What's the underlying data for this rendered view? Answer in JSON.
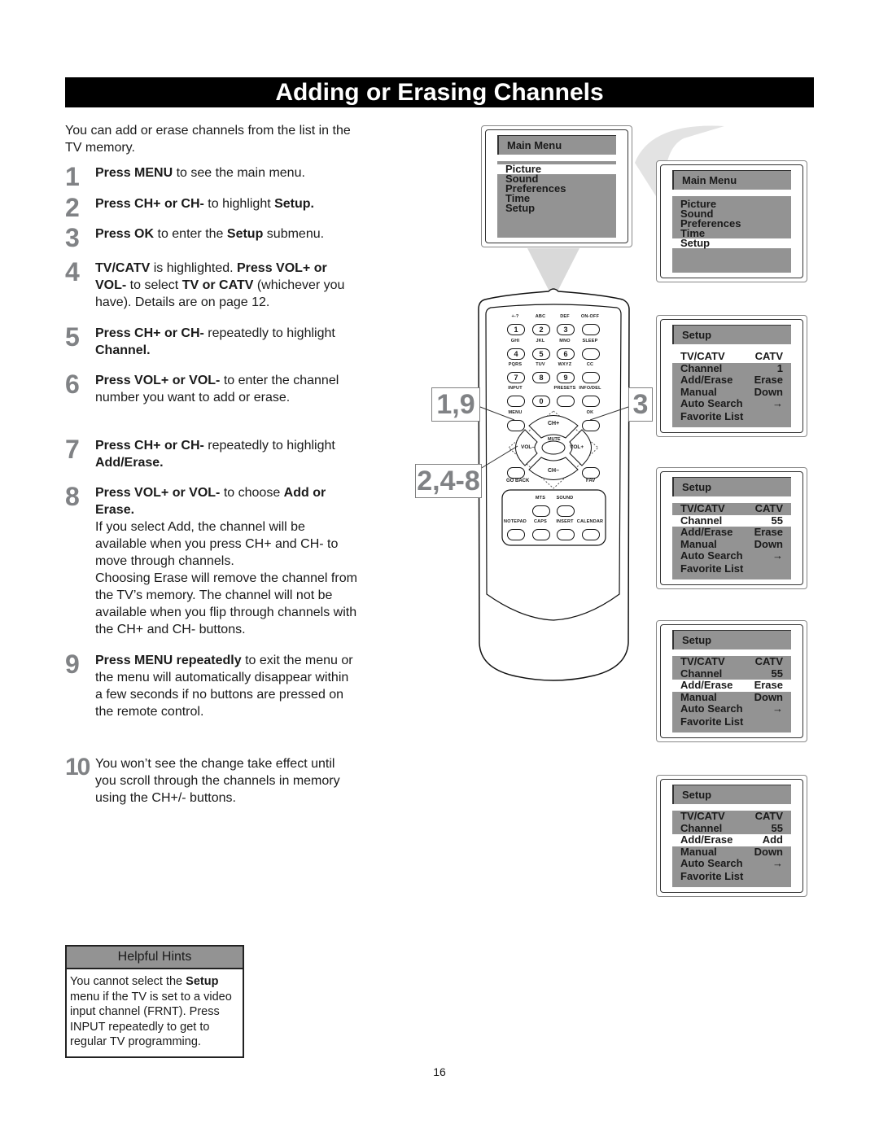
{
  "title": "Adding or Erasing Channels",
  "intro": "You can add or erase channels from the list in the TV memory.",
  "steps": [
    {
      "num": "1",
      "parts": [
        {
          "b": "Press MENU"
        },
        {
          "t": " to see the main menu."
        }
      ]
    },
    {
      "num": "2",
      "parts": [
        {
          "b": "Press CH+ or CH-"
        },
        {
          "t": " to highlight "
        },
        {
          "b": "Setup."
        }
      ]
    },
    {
      "num": "3",
      "parts": [
        {
          "b": "Press OK"
        },
        {
          "t": " to enter the "
        },
        {
          "b": "Setup"
        },
        {
          "t": " submenu."
        }
      ]
    },
    {
      "num": "4",
      "parts": [
        {
          "b": "TV/CATV"
        },
        {
          "t": " is highlighted. "
        },
        {
          "b": "Press VOL+ or VOL-"
        },
        {
          "t": " to select "
        },
        {
          "b": "TV or CATV"
        },
        {
          "t": " (whichever you have). Details are on page 12."
        }
      ]
    },
    {
      "num": "5",
      "parts": [
        {
          "b": "Press CH+ or CH-"
        },
        {
          "t": " repeatedly to highlight "
        },
        {
          "b": "Channel."
        }
      ]
    },
    {
      "num": "6",
      "parts": [
        {
          "b": "Press VOL+ or VOL-"
        },
        {
          "t": " to enter the channel number you want to add or erase."
        }
      ]
    },
    {
      "num": "7",
      "parts": [
        {
          "b": "Press CH+ or CH-"
        },
        {
          "t": " repeatedly to highlight "
        },
        {
          "b": "Add/Erase."
        }
      ]
    },
    {
      "num": "8",
      "parts": [
        {
          "b": "Press VOL+ or VOL-"
        },
        {
          "t": " to choose "
        },
        {
          "b": "Add or Erase."
        },
        {
          "br": true
        },
        {
          "t": "If you select Add, the channel will be available when you press CH+ and CH- to move through channels."
        },
        {
          "br": true
        },
        {
          "t": "Choosing Erase will remove the channel from the TV’s memory. The channel will not be available when you flip through channels with the CH+ and CH- buttons."
        }
      ]
    },
    {
      "num": "9",
      "parts": [
        {
          "b": "Press MENU repeatedly"
        },
        {
          "t": " to exit the menu or the menu will automatically disappear within a few seconds if no buttons are pressed on the remote control."
        }
      ]
    },
    {
      "num": "10",
      "parts": [
        {
          "t": "You won’t see the change take effect until you scroll through the channels in memory using the CH+/- buttons."
        }
      ]
    }
  ],
  "hints": {
    "header": "Helpful Hints",
    "parts": [
      {
        "t": "You cannot select the "
      },
      {
        "b": "Setup"
      },
      {
        "t": " menu if the TV is set to a video input channel (FRNT). Press INPUT repeatedly to get to regular TV programming."
      }
    ]
  },
  "page_number": "16",
  "callouts": {
    "left_top": "1,9",
    "left_bottom": "2,4-8",
    "right": "3"
  },
  "menus": [
    {
      "title": "Main Menu",
      "items": [
        {
          "l": "Picture"
        },
        {
          "l": "Sound"
        },
        {
          "l": "Preferences"
        },
        {
          "l": "Time"
        },
        {
          "l": "Setup"
        }
      ],
      "highlight": 0
    },
    {
      "title": "Main Menu",
      "items": [
        {
          "l": "Picture"
        },
        {
          "l": "Sound"
        },
        {
          "l": "Preferences"
        },
        {
          "l": "Time"
        },
        {
          "l": "Setup"
        }
      ],
      "highlight": 4
    },
    {
      "title": "Setup",
      "items": [
        {
          "l": "TV/CATV",
          "v": "CATV"
        },
        {
          "l": "Channel",
          "v": "1"
        },
        {
          "l": "Add/Erase",
          "v": "Erase"
        },
        {
          "l": "Manual",
          "v": "Down"
        },
        {
          "l": "Auto Search",
          "v": "→"
        },
        {
          "l": "Favorite List",
          "v": ""
        }
      ],
      "highlight": 0
    },
    {
      "title": "Setup",
      "items": [
        {
          "l": "TV/CATV",
          "v": "CATV"
        },
        {
          "l": "Channel",
          "v": "55"
        },
        {
          "l": "Add/Erase",
          "v": "Erase"
        },
        {
          "l": "Manual",
          "v": "Down"
        },
        {
          "l": "Auto Search",
          "v": "→"
        },
        {
          "l": "Favorite List",
          "v": ""
        }
      ],
      "highlight": 1
    },
    {
      "title": "Setup",
      "items": [
        {
          "l": "TV/CATV",
          "v": "CATV"
        },
        {
          "l": "Channel",
          "v": "55"
        },
        {
          "l": "Add/Erase",
          "v": "Erase"
        },
        {
          "l": "Manual",
          "v": "Down"
        },
        {
          "l": "Auto Search",
          "v": "→"
        },
        {
          "l": "Favorite List",
          "v": ""
        }
      ],
      "highlight": 2
    },
    {
      "title": "Setup",
      "items": [
        {
          "l": "TV/CATV",
          "v": "CATV"
        },
        {
          "l": "Channel",
          "v": "55"
        },
        {
          "l": "Add/Erase",
          "v": "Add"
        },
        {
          "l": "Manual",
          "v": "Down"
        },
        {
          "l": "Auto Search",
          "v": "→"
        },
        {
          "l": "Favorite List",
          "v": ""
        }
      ],
      "highlight": 2
    }
  ],
  "remote": {
    "keypad": [
      {
        "sub": "+-?",
        "key": "1"
      },
      {
        "sub": "ABC",
        "key": "2"
      },
      {
        "sub": "DEF",
        "key": "3"
      },
      {
        "sub": "ON-OFF",
        "key": ""
      },
      {
        "sub": "GHI",
        "key": "4"
      },
      {
        "sub": "JKL",
        "key": "5"
      },
      {
        "sub": "MNO",
        "key": "6"
      },
      {
        "sub": "SLEEP",
        "key": ""
      },
      {
        "sub": "PQRS",
        "key": "7"
      },
      {
        "sub": "TUV",
        "key": "8"
      },
      {
        "sub": "WXYZ",
        "key": "9"
      },
      {
        "sub": "CC",
        "key": ""
      },
      {
        "sub": "INPUT",
        "key": ""
      },
      {
        "sub": "",
        "key": "0"
      },
      {
        "sub": "PRESETS",
        "key": ""
      },
      {
        "sub": "INFO/DEL",
        "key": ""
      }
    ],
    "menu": "MENU",
    "ok": "OK",
    "ch_up": "CH+",
    "ch_down": "CH–",
    "vol_down": "VOL–",
    "vol_up": "VOL+",
    "mute": "MUTE",
    "go_back": "GO BACK",
    "fav": "FAV",
    "lower": [
      {
        "sub": "MTS"
      },
      {
        "sub": "SOUND"
      },
      {
        "sub": "NOTEPAD"
      },
      {
        "sub": "CAPS"
      },
      {
        "sub": "INSERT"
      },
      {
        "sub": "CALENDAR"
      }
    ]
  },
  "colors": {
    "step_number": "#808285",
    "menu_gray": "#939393",
    "title_bar": "#000000"
  }
}
